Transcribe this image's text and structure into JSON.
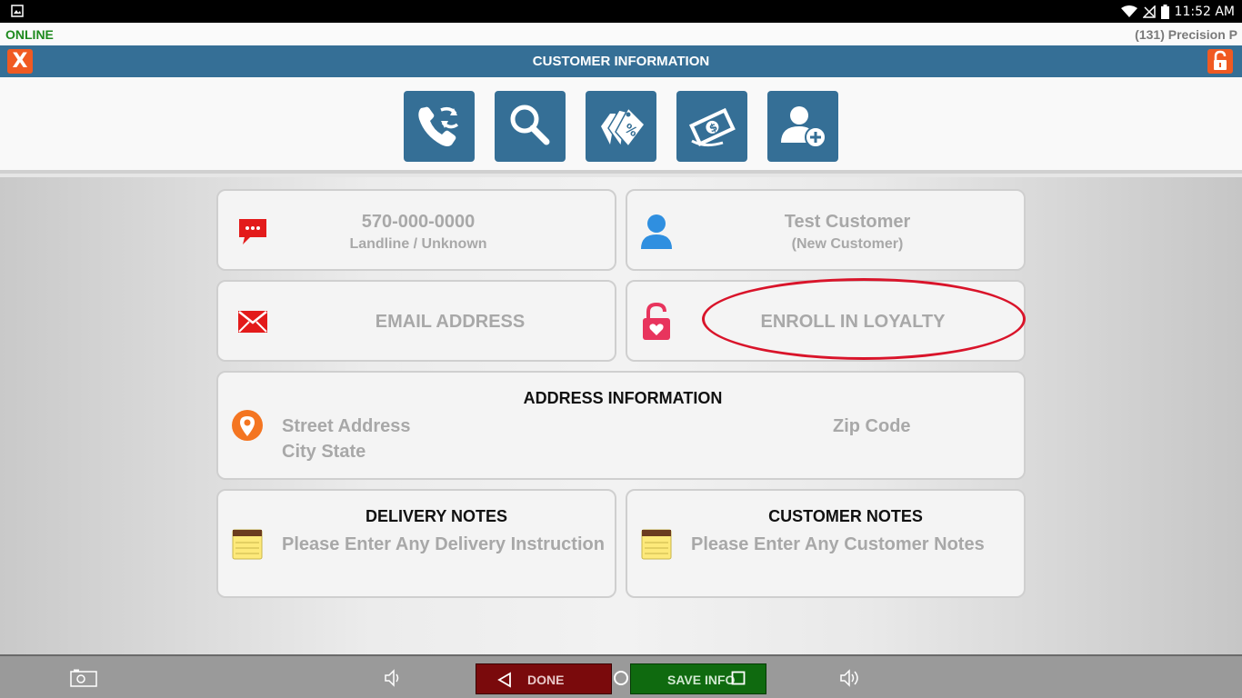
{
  "status_bar": {
    "time": "11:52 AM"
  },
  "online_bar": {
    "status": "ONLINE",
    "store": "(131) Precision P"
  },
  "title_bar": {
    "title": "CUSTOMER INFORMATION",
    "close_label": "X"
  },
  "toolbar": {
    "buttons": [
      "caller-id-icon",
      "search-icon",
      "discount-tags-icon",
      "cash-icon",
      "add-customer-icon"
    ]
  },
  "phone": {
    "number": "570-000-0000",
    "type": "Landline / Unknown"
  },
  "customer": {
    "name": "Test Customer",
    "status": "(New Customer)"
  },
  "email": {
    "placeholder": "EMAIL ADDRESS"
  },
  "loyalty": {
    "label": "ENROLL IN LOYALTY"
  },
  "address": {
    "title": "ADDRESS INFORMATION",
    "street_placeholder": "Street Address",
    "city_placeholder": "City State",
    "zip_placeholder": "Zip Code"
  },
  "delivery_notes": {
    "title": "DELIVERY NOTES",
    "placeholder": "Please Enter Any Delivery Instruction"
  },
  "customer_notes": {
    "title": "CUSTOMER NOTES",
    "placeholder": "Please Enter Any Customer Notes"
  },
  "nav_bar": {
    "done_label": "DONE",
    "save_label": "SAVE INFO"
  },
  "colors": {
    "brand": "#356f96",
    "accent": "#f05a22",
    "online": "#1e8a1e",
    "annotation": "#d9142a"
  }
}
